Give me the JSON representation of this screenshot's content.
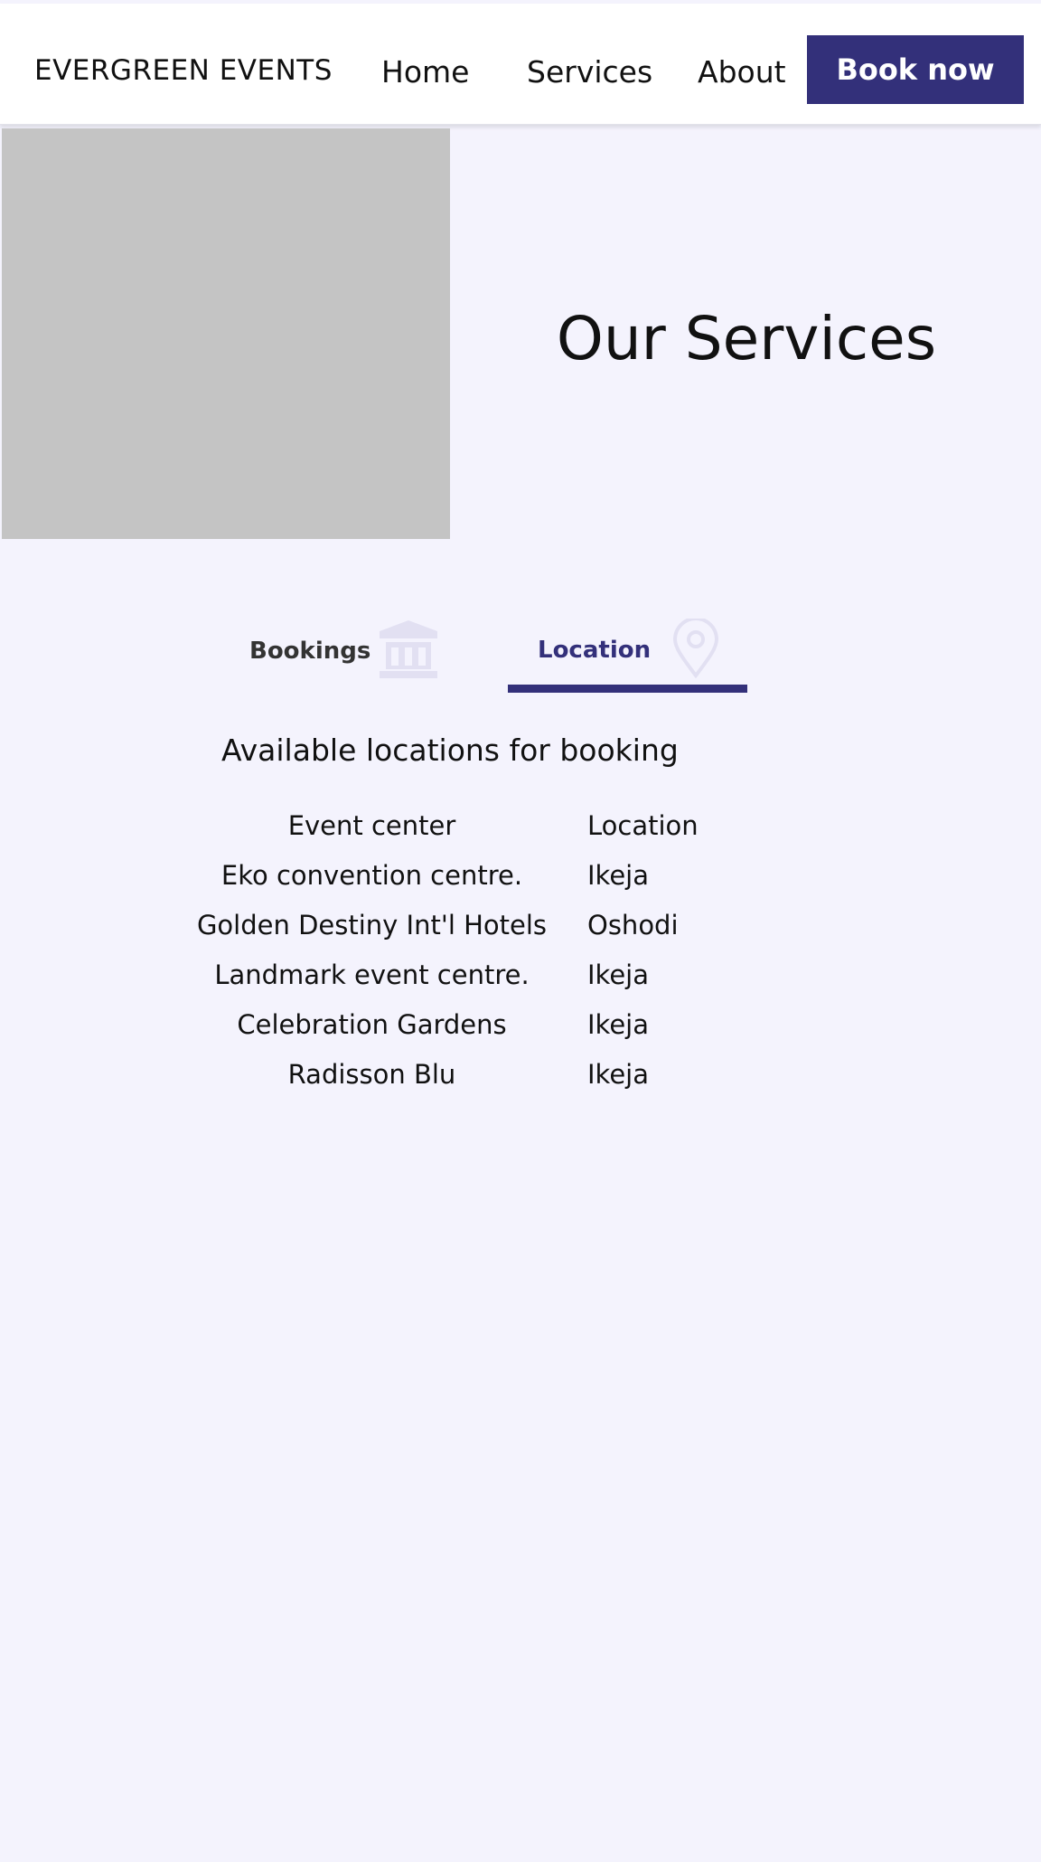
{
  "header": {
    "brand": "EVERGREEN EVENTS",
    "nav": [
      "Home",
      "Services",
      "About"
    ],
    "cta_label": "Book now"
  },
  "hero": {
    "title": "Our Services"
  },
  "tabs": [
    {
      "label": "Bookings",
      "icon": "bank-building-icon",
      "active": false
    },
    {
      "label": "Location",
      "icon": "map-pin-icon",
      "active": true
    }
  ],
  "locations": {
    "heading": "Available locations for booking",
    "columns": [
      "Event center",
      "Location"
    ],
    "rows": [
      [
        "Eko convention centre.",
        "Ikeja"
      ],
      [
        "Golden Destiny Int'l Hotels",
        "Oshodi"
      ],
      [
        "Landmark event centre.",
        "Ikeja"
      ],
      [
        "Celebration Gardens",
        "Ikeja"
      ],
      [
        "Radisson Blu",
        "Ikeja"
      ]
    ]
  },
  "colors": {
    "accent": "#33307a",
    "page_bg": "#f4f3fd",
    "placeholder": "#c4c4c4",
    "icon_tint": "#e2e0f2"
  }
}
